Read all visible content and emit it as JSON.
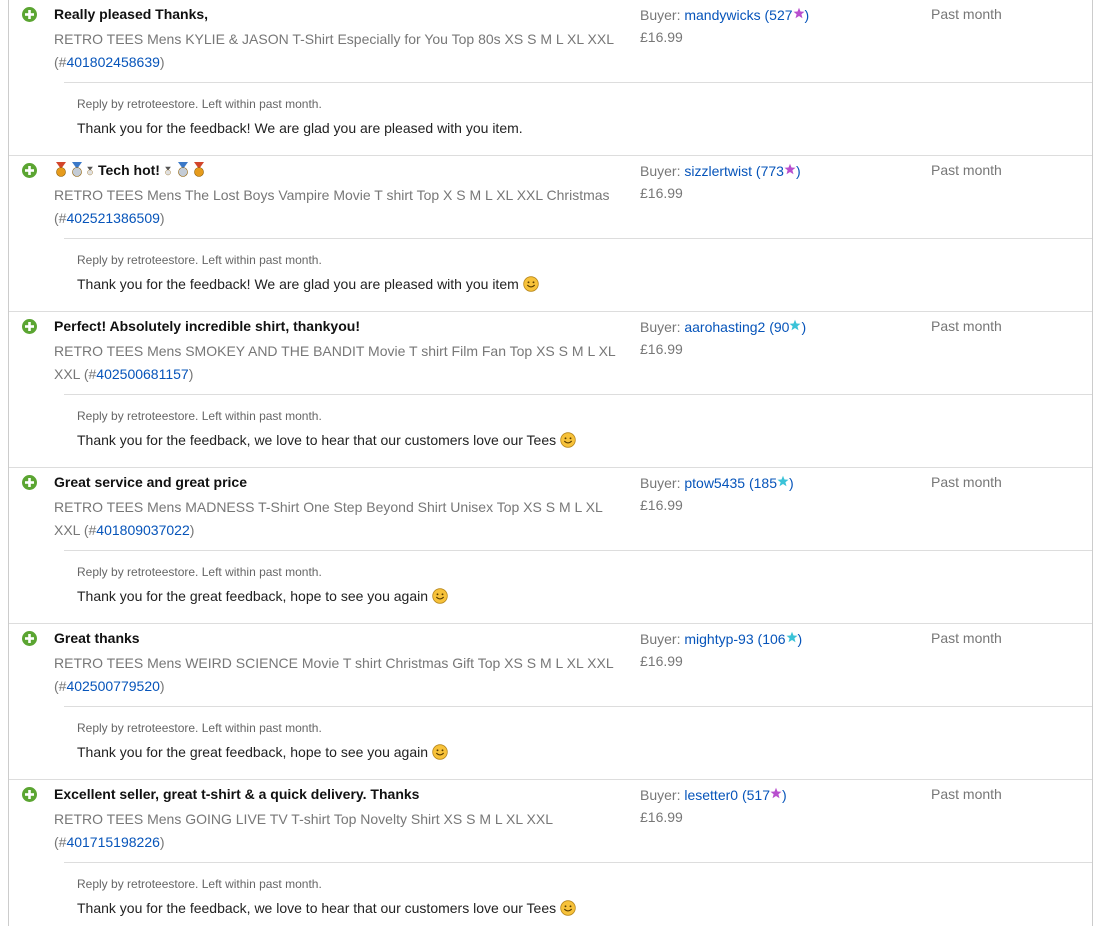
{
  "colors": {
    "positive_icon": "#5ba532",
    "link": "#0654ba",
    "star_purple": "#b84fce",
    "star_turquoise": "#3bc3d8"
  },
  "labels": {
    "buyer_prefix": "Buyer:",
    "reply_prefix": "Reply by retroteestore. Left within past month."
  },
  "entries": [
    {
      "comment": "Really pleased Thanks,",
      "medals": false,
      "item": "RETRO TEES Mens KYLIE & JASON T-Shirt Especially for You Top 80s XS S M L XL XXL",
      "item_id": "401802458639",
      "buyer": "mandywicks",
      "score": "527",
      "star_color": "purple",
      "price": "£16.99",
      "when": "Past month",
      "reply": "Thank you for the feedback! We are glad you are pleased with you item.",
      "reply_smiley": false
    },
    {
      "comment": "Tech hot!",
      "medals": true,
      "item": "RETRO TEES Mens The Lost Boys Vampire Movie T shirt Top X S M L XL XXL Christmas",
      "item_id": "402521386509",
      "buyer": "sizzlertwist",
      "score": "773",
      "star_color": "purple",
      "price": "£16.99",
      "when": "Past month",
      "reply": "Thank you for the feedback! We are glad you are pleased with you item",
      "reply_smiley": true
    },
    {
      "comment": "Perfect! Absolutely incredible shirt, thankyou!",
      "medals": false,
      "item": "RETRO TEES Mens SMOKEY AND THE BANDIT Movie T shirt Film Fan Top XS S M L XL XXL",
      "item_id": "402500681157",
      "buyer": "aarohasting2",
      "score": "90",
      "star_color": "turquoise",
      "price": "£16.99",
      "when": "Past month",
      "reply": "Thank you for the feedback, we love to hear that our customers love our Tees",
      "reply_smiley": true
    },
    {
      "comment": "Great service and great price",
      "medals": false,
      "item": "RETRO TEES Mens MADNESS T-Shirt One Step Beyond Shirt Unisex Top XS S M L XL XXL",
      "item_id": "401809037022",
      "buyer": "ptow5435",
      "score": "185",
      "star_color": "turquoise",
      "price": "£16.99",
      "when": "Past month",
      "reply": "Thank you for the great feedback, hope to see you again",
      "reply_smiley": true
    },
    {
      "comment": "Great thanks",
      "medals": false,
      "item": "RETRO TEES Mens WEIRD SCIENCE Movie T shirt Christmas Gift Top XS S M L XL XXL",
      "item_id": "402500779520",
      "buyer": "mightyp-93",
      "score": "106",
      "star_color": "turquoise",
      "price": "£16.99",
      "when": "Past month",
      "reply": "Thank you for the great feedback, hope to see you again",
      "reply_smiley": true
    },
    {
      "comment": "Excellent seller, great t-shirt & a quick delivery. Thanks",
      "medals": false,
      "item": "RETRO TEES Mens GOING LIVE TV T-shirt Top Novelty Shirt XS S M L XL XXL",
      "item_id": "401715198226",
      "buyer": "lesetter0",
      "score": "517",
      "star_color": "purple",
      "price": "£16.99",
      "when": "Past month",
      "reply": "Thank you for the feedback, we love to hear that our customers love our Tees",
      "reply_smiley": true
    }
  ]
}
